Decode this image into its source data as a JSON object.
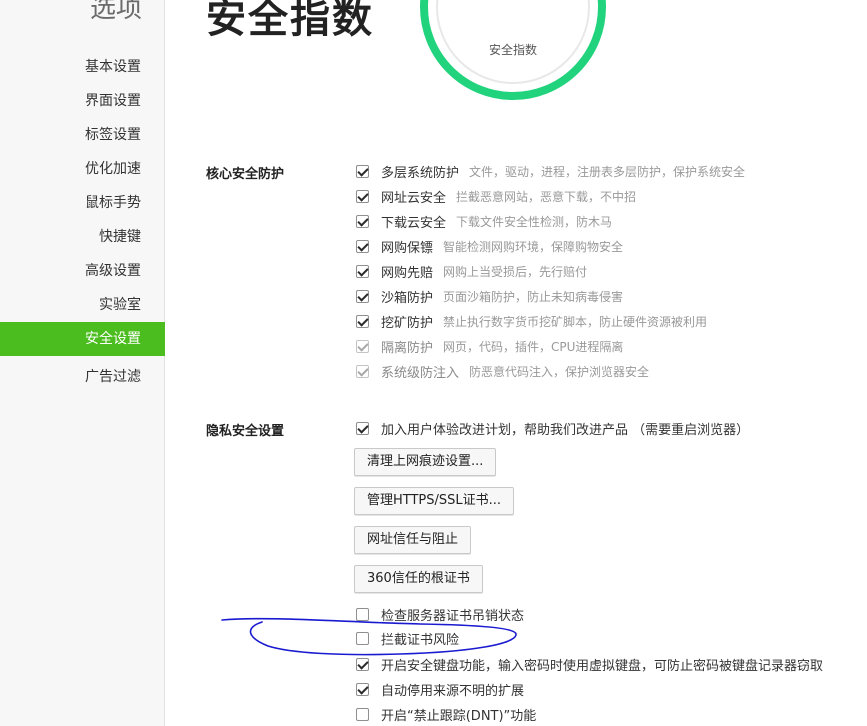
{
  "sidebar": {
    "title": "选项",
    "items": [
      {
        "label": "基本设置"
      },
      {
        "label": "界面设置"
      },
      {
        "label": "标签设置"
      },
      {
        "label": "优化加速"
      },
      {
        "label": "鼠标手势"
      },
      {
        "label": "快捷键"
      },
      {
        "label": "高级设置"
      },
      {
        "label": "实验室"
      },
      {
        "label": "安全设置",
        "active": true
      },
      {
        "label": "广告过滤"
      }
    ]
  },
  "header": {
    "title": "安全指数",
    "gauge_label": "安全指数",
    "gauge_color": "#21d37c"
  },
  "core": {
    "label": "核心安全防护",
    "options": [
      {
        "label": "多层系统防护",
        "desc": "文件，驱动，进程，注册表多层防护，保护系统安全",
        "checked": true
      },
      {
        "label": "网址云安全",
        "desc": "拦截恶意网站，恶意下载，不中招",
        "checked": true
      },
      {
        "label": "下载云安全",
        "desc": "下载文件安全性检测，防木马",
        "checked": true
      },
      {
        "label": "网购保镖",
        "desc": "智能检测网购环境，保障购物安全",
        "checked": true
      },
      {
        "label": "网购先赔",
        "desc": "网购上当受损后，先行赔付",
        "checked": true
      },
      {
        "label": "沙箱防护",
        "desc": "页面沙箱防护，防止未知病毒侵害",
        "checked": true
      },
      {
        "label": "挖矿防护",
        "desc": "禁止执行数字货币挖矿脚本，防止硬件资源被利用",
        "checked": true
      },
      {
        "label": "隔离防护",
        "desc": "网页，代码，插件，CPU进程隔离",
        "checked": true,
        "disabled": true
      },
      {
        "label": "系统级防注入",
        "desc": "防恶意代码注入，保护浏览器安全",
        "checked": true,
        "disabled": true
      }
    ]
  },
  "privacy": {
    "label": "隐私安全设置",
    "join_program": "加入用户体验改进计划，帮助我们改进产品 （需要重启浏览器）",
    "buttons": {
      "clear_traces": "清理上网痕迹设置...",
      "manage_certs": "管理HTTPS/SSL证书...",
      "url_trust": "网址信任与阻止",
      "root_certs": "360信任的根证书"
    },
    "options": [
      {
        "label": "检查服务器证书吊销状态",
        "checked": false
      },
      {
        "label": "拦截证书风险",
        "checked": false
      },
      {
        "label": "开启安全键盘功能，输入密码时使用虚拟键盘，可防止密码被键盘记录器窃取",
        "checked": true
      },
      {
        "label": "自动停用来源不明的扩展",
        "checked": true
      },
      {
        "label": "开启“禁止跟踪(DNT)”功能",
        "checked": false
      }
    ]
  },
  "colors": {
    "accent": "#4bbd1f",
    "annotation": "#1a1ad0"
  }
}
